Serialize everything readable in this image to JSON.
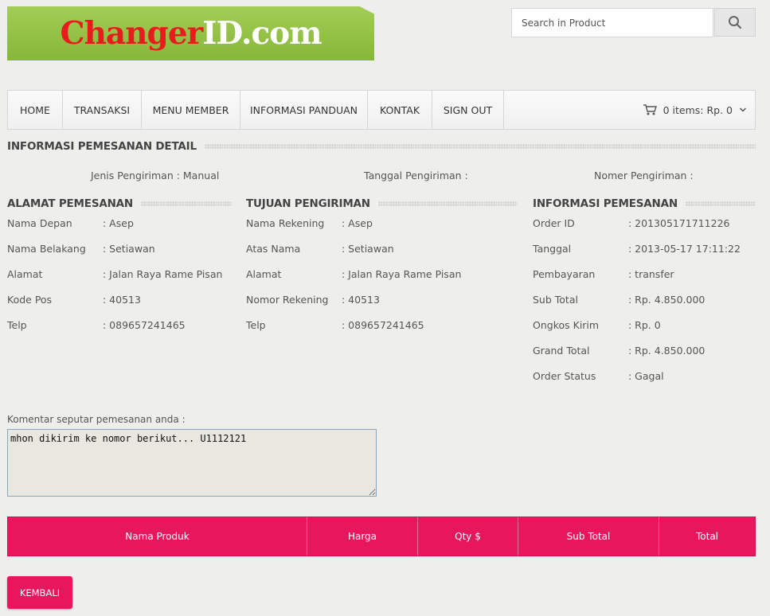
{
  "logo": {
    "part1": "Changer",
    "part2": "ID.com"
  },
  "search": {
    "placeholder": "Search in Product"
  },
  "nav": {
    "items": [
      "HOME",
      "TRANSAKSI",
      "MENU MEMBER",
      "INFORMASI PANDUAN",
      "KONTAK",
      "SIGN OUT"
    ],
    "cart": "0 items: Rp. 0"
  },
  "detail": {
    "title": "INFORMASI PEMESANAN DETAIL",
    "jenis": "Jenis Pengiriman : Manual",
    "tanggal": "Tanggal Pengiriman :",
    "nomer": "Nomer Pengiriman :"
  },
  "alamat": {
    "title": "ALAMAT PEMESANAN",
    "rows": [
      {
        "label": "Nama Depan",
        "value": ": Asep"
      },
      {
        "label": "Nama Belakang",
        "value": ": Setiawan"
      },
      {
        "label": "Alamat",
        "value": ": Jalan Raya Rame Pisan"
      },
      {
        "label": "Kode Pos",
        "value": ": 40513"
      },
      {
        "label": "Telp",
        "value": ": 089657241465"
      }
    ]
  },
  "tujuan": {
    "title": "TUJUAN PENGIRIMAN",
    "rows": [
      {
        "label": "Nama Rekening",
        "value": ": Asep"
      },
      {
        "label": "Atas Nama",
        "value": ": Setiawan"
      },
      {
        "label": "Alamat",
        "value": ": Jalan Raya Rame Pisan"
      },
      {
        "label": "Nomor Rekening",
        "value": ": 40513"
      },
      {
        "label": "Telp",
        "value": ": 089657241465"
      }
    ]
  },
  "info": {
    "title": "INFORMASI PEMESANAN",
    "rows": [
      {
        "label": "Order ID",
        "value": ": 201305171711226"
      },
      {
        "label": "Tanggal",
        "value": ": 2013-05-17 17:11:22"
      },
      {
        "label": "Pembayaran",
        "value": ": transfer"
      },
      {
        "label": "Sub Total",
        "value": ": Rp. 4.850.000"
      },
      {
        "label": "Ongkos Kirim",
        "value": ": Rp. 0"
      },
      {
        "label": "Grand Total",
        "value": ": Rp. 4.850.000"
      },
      {
        "label": "Order Status",
        "value": ": Gagal"
      }
    ]
  },
  "comment": {
    "label": "Komentar seputar pemesanan anda :",
    "value": "mhon dikirim ke nomor berikut... U1112121"
  },
  "table": {
    "headers": [
      "Nama Produk",
      "Harga",
      "Qty $",
      "Sub Total",
      "Total"
    ]
  },
  "back_label": "KEMBALI",
  "colors": {
    "accent": "#e8175d",
    "logo_green": "#8fbf42",
    "logo_red": "#e81c1c"
  }
}
